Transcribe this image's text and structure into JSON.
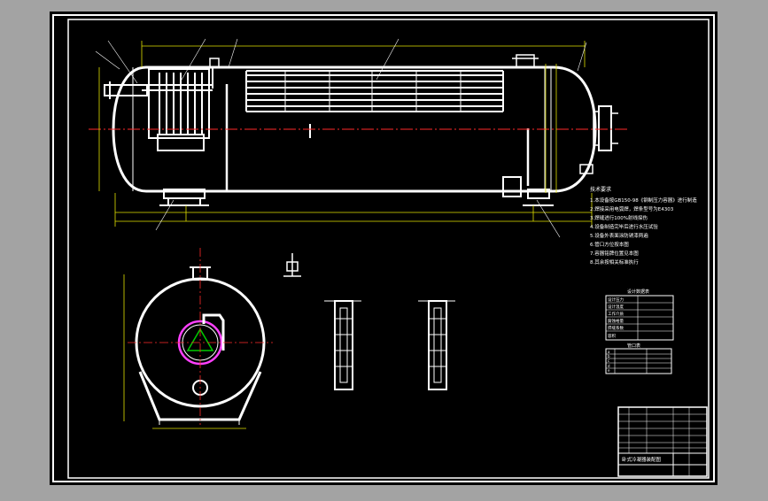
{
  "drawing": {
    "background_color": "#a3a3a3",
    "sheet_color": "#000000",
    "border_color": "#ffffff",
    "line_color": "#ffffff",
    "dimension_color": "#e0e000",
    "centerline_color": "#ff2a2a",
    "dim_text_color": "#00cc00",
    "accent_color": "#ff40ff"
  },
  "tech_requirements": {
    "title": "技术要求",
    "lines": [
      "1.本设备按GB150-98《钢制压力容器》进行制造",
      "2.焊接采用电弧焊，焊条型号为E4303",
      "3.焊缝进行100%射线探伤",
      "4.设备制造完毕后进行水压试验",
      "5.设备外表面涂防锈漆两遍",
      "6.管口方位按本图",
      "7.容器铭牌位置见本图",
      "8.其余按相关标准执行"
    ]
  },
  "design_data": {
    "title": "设计数据表",
    "rows": [
      "设计压力",
      "设计温度",
      "工作介质",
      "腐蚀裕量",
      "焊缝系数",
      "容积"
    ]
  },
  "nozzle_table": {
    "title": "管口表",
    "rows": [
      "a",
      "b",
      "c",
      "d",
      "e"
    ]
  },
  "title_block": {
    "drawing_name": "卧式冷凝器装配图"
  }
}
